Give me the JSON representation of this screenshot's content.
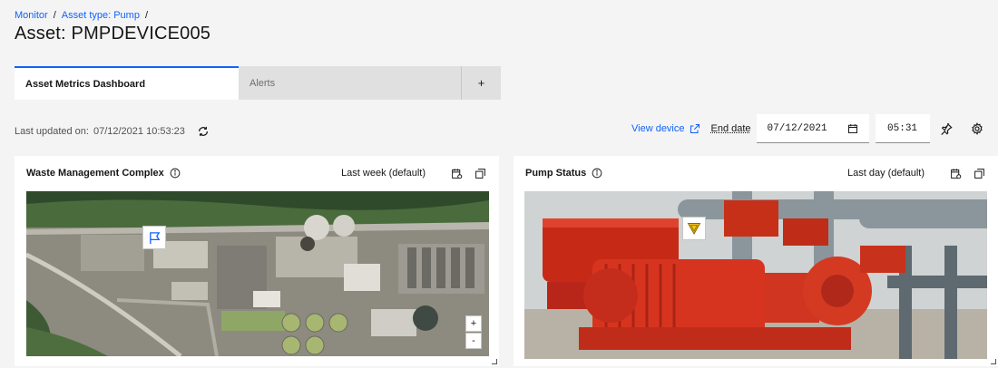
{
  "breadcrumb": {
    "items": [
      "Monitor",
      "Asset type: Pump"
    ],
    "separator": "/"
  },
  "page": {
    "title": "Asset: PMPDEVICE005"
  },
  "tabs": [
    {
      "label": "Asset Metrics Dashboard",
      "active": true
    },
    {
      "label": "Alerts",
      "active": false
    },
    {
      "label": "+",
      "active": false
    }
  ],
  "status": {
    "last_updated_label": "Last updated on:",
    "last_updated_value": "07/12/2021 10:53:23"
  },
  "toolbar": {
    "view_device": "View device",
    "end_date_label": "End date",
    "end_date_value": "07/12/2021",
    "time_value": "05:31"
  },
  "cards": [
    {
      "title": "Waste Management Complex",
      "range": "Last week (default)",
      "icons": [
        "info-icon",
        "calendar-settings-icon",
        "expand-icon"
      ],
      "map_controls": {
        "zoom_in": "+",
        "zoom_out": "-"
      }
    },
    {
      "title": "Pump Status",
      "range": "Last day (default)",
      "icons": [
        "info-icon",
        "calendar-settings-icon",
        "expand-icon"
      ]
    }
  ],
  "colors": {
    "accent": "#0f62fe",
    "warning": "#f1c21b",
    "pump_red": "#d7341f"
  }
}
